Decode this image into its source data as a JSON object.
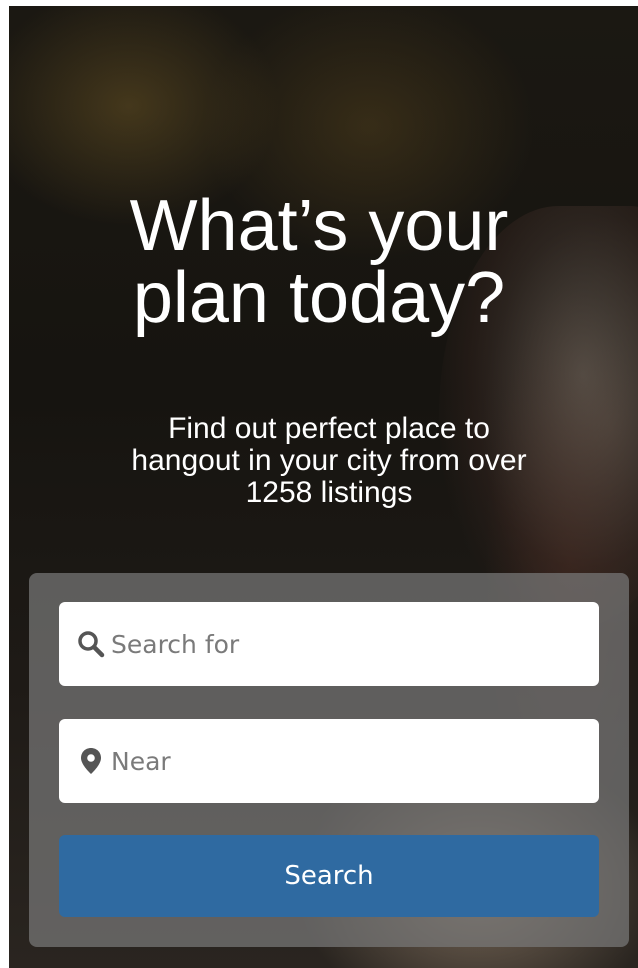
{
  "hero": {
    "title_line1": "What’s your",
    "title_line2": "plan today?",
    "subtitle_line1": "Find out perfect place to",
    "subtitle_line2": "hangout in your city from over",
    "subtitle_line3": "1258 listings"
  },
  "search_form": {
    "search_field": {
      "placeholder": "Search for",
      "value": "",
      "icon": "search-icon"
    },
    "near_field": {
      "placeholder": "Near",
      "value": "",
      "icon": "map-marker-icon"
    },
    "button_label": "Search"
  },
  "colors": {
    "button": "#2f6aa1",
    "panel": "#787878",
    "text": "#ffffff"
  }
}
